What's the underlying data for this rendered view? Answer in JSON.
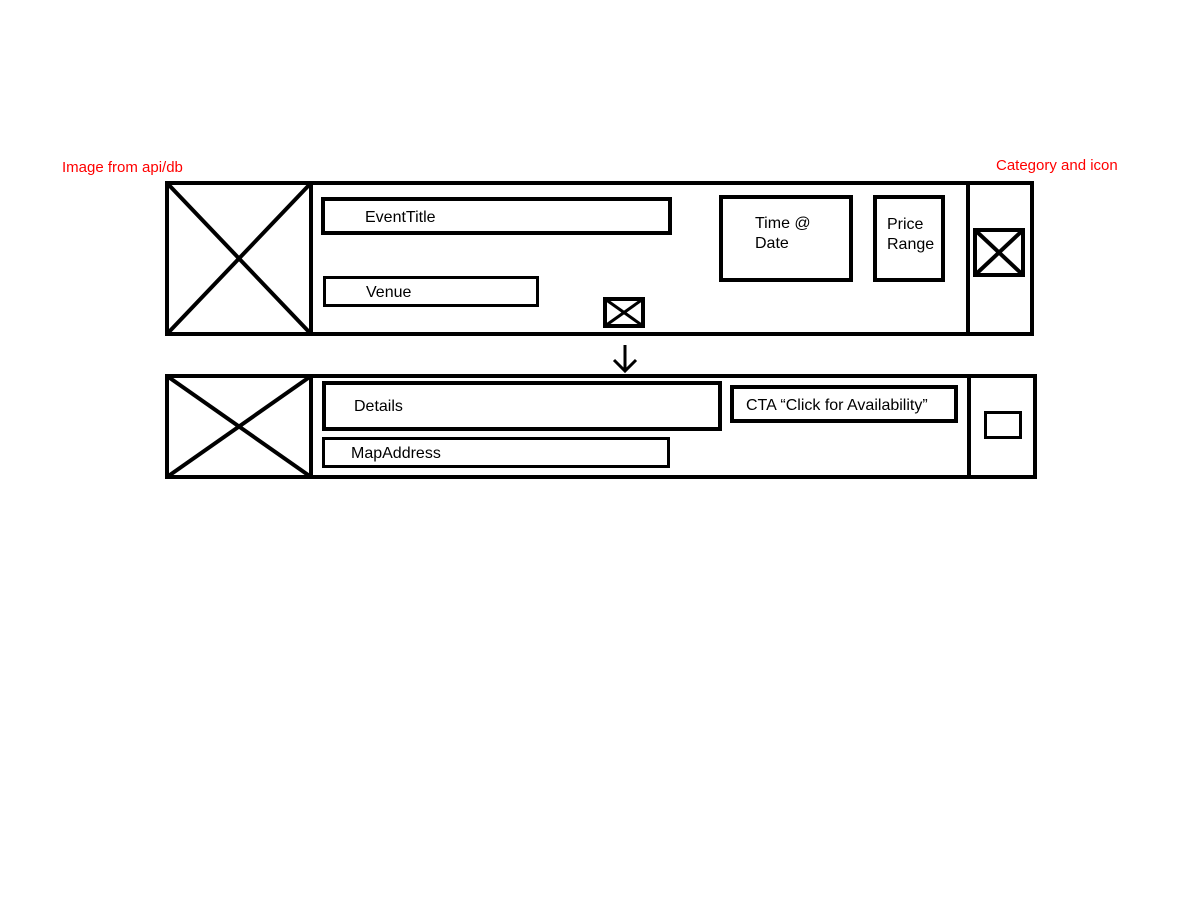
{
  "annotations": {
    "image_source": "Image from api/db",
    "category": "Category and icon"
  },
  "collapsed_card": {
    "image_placeholder": "image-placeholder",
    "event_title": "EventTitle",
    "venue": "Venue",
    "time_date_line1": "Time @",
    "time_date_line2": "Date",
    "price_line1": "Price",
    "price_line2": "Range",
    "expand_toggle": "expand-toggle-icon",
    "category_icon": "category-icon"
  },
  "expanded_card": {
    "image_placeholder": "image-placeholder",
    "details": "Details",
    "map_address": "MapAddress",
    "cta": "CTA “Click for Availability”",
    "category_icon": "category-icon"
  },
  "connector": "arrow-down-icon",
  "colors": {
    "annotation": "#ff0000",
    "stroke": "#000000"
  }
}
